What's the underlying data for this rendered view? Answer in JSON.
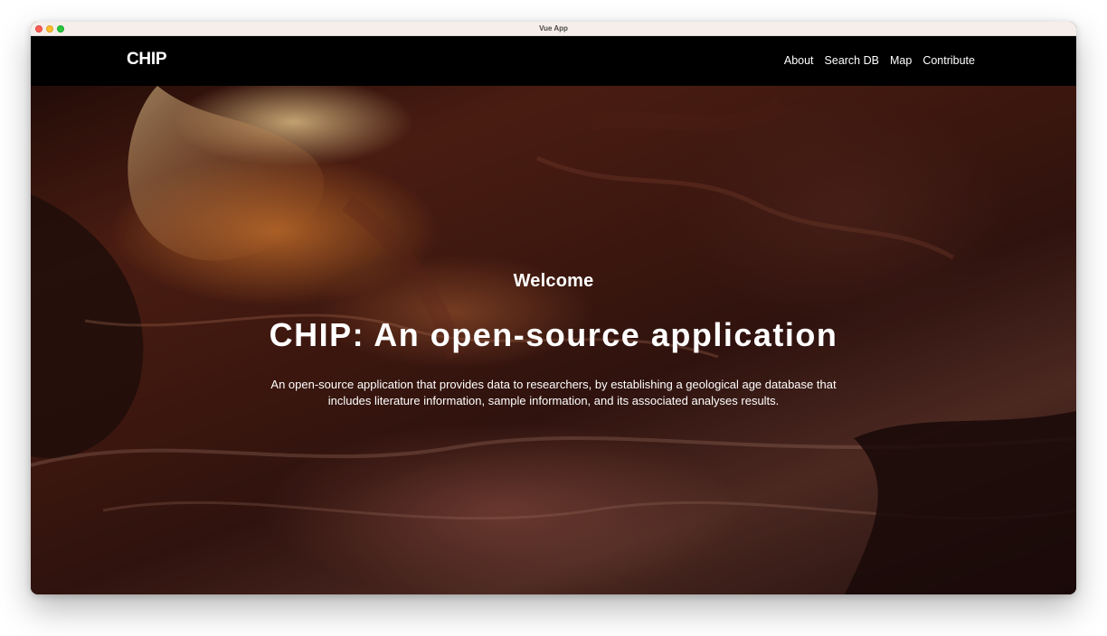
{
  "window": {
    "title": "Vue App"
  },
  "navbar": {
    "brand": "CHIP",
    "links": [
      {
        "label": "About"
      },
      {
        "label": "Search DB"
      },
      {
        "label": "Map"
      },
      {
        "label": "Contribute"
      }
    ]
  },
  "hero": {
    "welcome": "Welcome",
    "headline": "CHIP: An open-source application",
    "description": "An open-source application that provides data to researchers, by establishing a geological age database that includes literature information, sample information, and its associated analyses results.",
    "background_image": "canyon-sandstone-photo"
  },
  "colors": {
    "navbar_bg": "#000000",
    "text": "#ffffff",
    "titlebar_bg": "#f6eeea"
  }
}
